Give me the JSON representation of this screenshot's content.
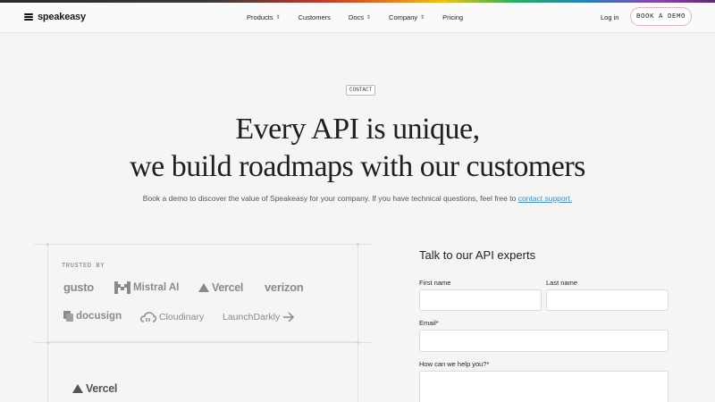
{
  "header": {
    "logo_text": "speakeasy",
    "nav": [
      {
        "label": "Products",
        "dropdown": true
      },
      {
        "label": "Customers",
        "dropdown": false
      },
      {
        "label": "Docs",
        "dropdown": true
      },
      {
        "label": "Company",
        "dropdown": true
      },
      {
        "label": "Pricing",
        "dropdown": false
      }
    ],
    "login_label": "Log in",
    "demo_label": "BOOK A DEMO"
  },
  "hero": {
    "badge": "CONTACT",
    "title_line1": "Every API is unique,",
    "title_line2": "we build roadmaps with our customers",
    "subtitle": "Book a demo to discover the value of Speakeasy for your company. If you have technical questions, feel free to",
    "subtitle_link": "contact support."
  },
  "trusted": {
    "label": "TRUSTED BY",
    "brands": {
      "gusto": "gusto",
      "mistral": "Mistral AI",
      "vercel": "Vercel",
      "verizon": "verizon",
      "docusign": "docusign",
      "cloudinary": "Cloudinary",
      "launchdarkly": "LaunchDarkly"
    },
    "testimonial_brand": "Vercel"
  },
  "form": {
    "title": "Talk to our API experts",
    "first_name_label": "First name",
    "last_name_label": "Last name",
    "email_label": "Email*",
    "help_label": "How can we help you?*"
  },
  "colors": {
    "background": "#f5f5f4",
    "link": "#3a8ed8",
    "demo_border": "#e8b4b8"
  }
}
